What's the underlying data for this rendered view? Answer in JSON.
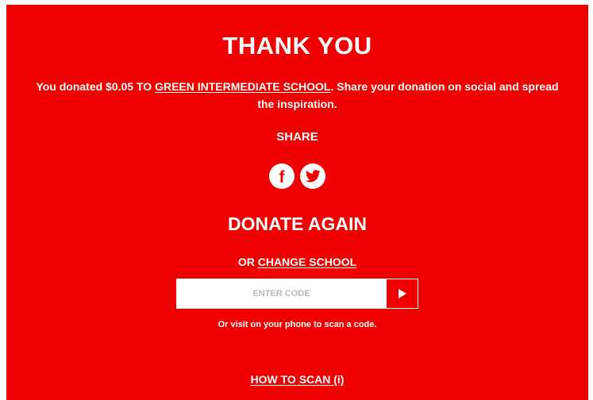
{
  "colors": {
    "background": "#ef0000",
    "text": "#ffffff",
    "input_background": "#ffffff",
    "placeholder": "#b8b8b8"
  },
  "heading": {
    "title": "THANK YOU"
  },
  "message": {
    "prefix": "You donated $0.05 TO ",
    "school_name": "GREEN INTERMEDIATE SCHOOL",
    "suffix": ". Share your donation on social and spread the inspiration."
  },
  "share": {
    "label": "SHARE",
    "facebook_glyph": "f",
    "icons": [
      "facebook-icon",
      "twitter-icon"
    ]
  },
  "donate_again": {
    "title": "DONATE AGAIN",
    "or_text": "OR ",
    "change_school_link": "CHANGE SCHOOL"
  },
  "code_entry": {
    "placeholder": "ENTER CODE",
    "value": "",
    "submit_icon": "play-arrow-icon"
  },
  "hint": "Or visit on your phone to scan a code.",
  "how_to_scan_link": "HOW TO SCAN (i)"
}
